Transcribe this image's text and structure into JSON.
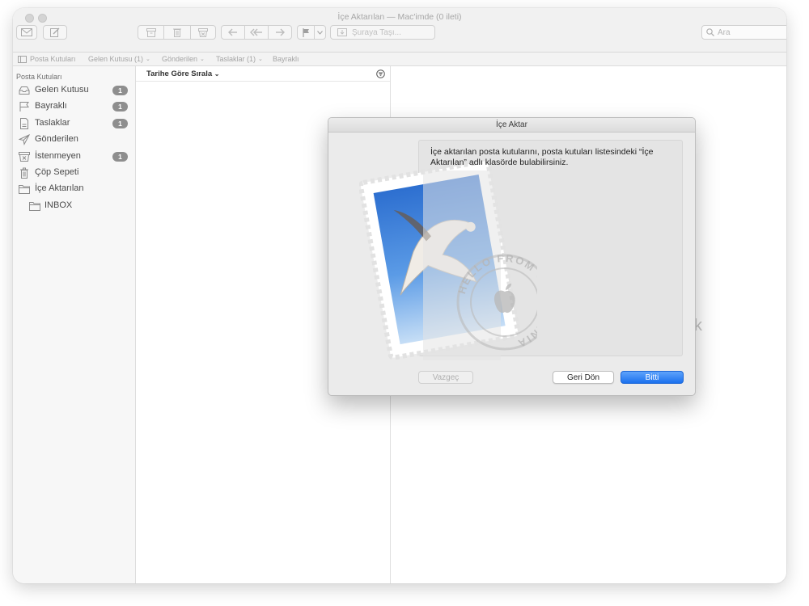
{
  "window": {
    "title": "İçe Aktarılan — Mac'imde (0 ileti)"
  },
  "toolbar": {
    "move_to_label": "Şuraya Taşı...",
    "search_placeholder": "Ara"
  },
  "favorites_bar": {
    "items": [
      {
        "label": "Posta Kutuları",
        "has_chevron": false
      },
      {
        "label": "Gelen Kutusu (1)",
        "has_chevron": true
      },
      {
        "label": "Gönderilen",
        "has_chevron": true
      },
      {
        "label": "Taslaklar (1)",
        "has_chevron": true
      },
      {
        "label": "Bayraklı",
        "has_chevron": false
      }
    ]
  },
  "sidebar": {
    "header": "Posta Kutuları",
    "items": [
      {
        "label": "Gelen Kutusu",
        "icon": "inbox-icon",
        "badge": "1"
      },
      {
        "label": "Bayraklı",
        "icon": "flag-icon",
        "badge": "1"
      },
      {
        "label": "Taslaklar",
        "icon": "draft-icon",
        "badge": "1"
      },
      {
        "label": "Gönderilen",
        "icon": "paper-plane-icon",
        "badge": ""
      },
      {
        "label": "İstenmeyen",
        "icon": "junk-icon",
        "badge": "1"
      },
      {
        "label": "Çöp Sepeti",
        "icon": "trash-icon",
        "badge": ""
      },
      {
        "label": "İçe Aktarılan",
        "icon": "folder-icon",
        "badge": ""
      },
      {
        "label": "INBOX",
        "icon": "folder-icon",
        "badge": ""
      }
    ]
  },
  "message_list": {
    "sort_label": "Tarihe Göre Sırala"
  },
  "preview": {
    "placeholder_fragment": "k"
  },
  "dialog": {
    "title": "İçe Aktar",
    "message": "İçe aktarılan posta kutularını, posta kutuları listesindeki “İçe Aktarılan” adlı klasörde bulabilirsiniz.",
    "stamp_text": "HELLO FROM CALIFORNIA",
    "cancel_label": "Vazgeç",
    "back_label": "Geri Dön",
    "done_label": "Bitti"
  },
  "colors": {
    "accent": "#1b71ee",
    "badge": "#8e8e8e",
    "sidebar_bg": "#f7f7f7"
  }
}
